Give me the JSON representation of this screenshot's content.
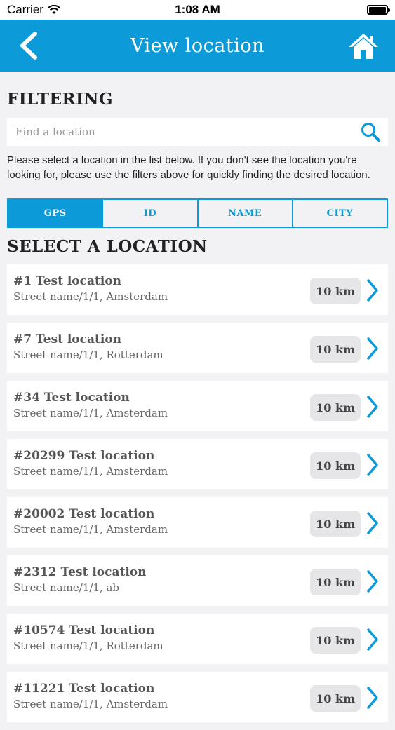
{
  "status_bar": {
    "carrier": "Carrier",
    "time": "1:08 AM"
  },
  "nav": {
    "title": "View location",
    "back_icon": "chevron-left-icon",
    "home_icon": "home-icon"
  },
  "filtering": {
    "heading": "FILTERING",
    "search_placeholder": "Find a location",
    "search_value": "",
    "help_text": "Please select a location in the list below. If you don't see the location you're looking for, please use the filters above for quickly finding the desired location."
  },
  "tabs": [
    {
      "label": "GPS",
      "active": true
    },
    {
      "label": "ID",
      "active": false
    },
    {
      "label": "NAME",
      "active": false
    },
    {
      "label": "CITY",
      "active": false
    }
  ],
  "list_heading": "SELECT A LOCATION",
  "locations": [
    {
      "title": "#1 Test location",
      "address": "Street name/1/1, Amsterdam",
      "distance": "10 km"
    },
    {
      "title": "#7 Test location",
      "address": "Street name/1/1, Rotterdam",
      "distance": "10 km"
    },
    {
      "title": "#34 Test location",
      "address": "Street name/1/1, Amsterdam",
      "distance": "10 km"
    },
    {
      "title": "#20299 Test location",
      "address": "Street name/1/1, Amsterdam",
      "distance": "10 km"
    },
    {
      "title": "#20002 Test location",
      "address": "Street name/1/1, Amsterdam",
      "distance": "10 km"
    },
    {
      "title": "#2312 Test location",
      "address": "Street name/1/1, ab",
      "distance": "10 km"
    },
    {
      "title": "#10574 Test location",
      "address": "Street name/1/1, Rotterdam",
      "distance": "10 km"
    },
    {
      "title": "#11221 Test location",
      "address": "Street name/1/1, Amsterdam",
      "distance": "10 km"
    }
  ],
  "colors": {
    "accent": "#0c9ad8",
    "background": "#f2f2f4"
  }
}
